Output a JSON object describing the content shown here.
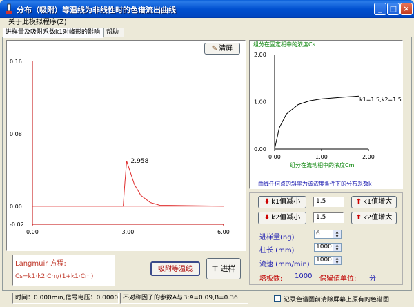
{
  "window": {
    "title": "分布（吸附）等温线为非线性时的色谱流出曲线",
    "buttons": {
      "minimize": "_",
      "maximize": "□",
      "close": "×"
    }
  },
  "menu": {
    "about": "关于此模拟程序(Z)"
  },
  "tabs": [
    {
      "label": "进样量及吸附系数k1对峰形的影响"
    },
    {
      "label": "帮助"
    }
  ],
  "left_chart": {
    "clear_button": "清屏",
    "y_ticks": [
      "0.16",
      "0.08",
      "0.00",
      "-0.02"
    ],
    "x_ticks": [
      "0.00",
      "3.00",
      "6.00"
    ],
    "peak_label": "2.958",
    "colors": {
      "axis": "#c00000",
      "curve": "#e03030",
      "baseline": "#e03030"
    },
    "chart_data": {
      "type": "line",
      "xlim": [
        0,
        6
      ],
      "ylim": [
        -0.02,
        0.16
      ],
      "baseline_y": 0.0,
      "series": [
        {
          "x": [
            0.0,
            2.85,
            2.9,
            2.958,
            3.05,
            3.2,
            3.4,
            3.7,
            4.0,
            6.0
          ],
          "y": [
            0.0,
            0.0,
            0.025,
            0.05,
            0.04,
            0.024,
            0.012,
            0.004,
            0.001,
            0.0
          ]
        }
      ]
    }
  },
  "right_chart": {
    "title": "组分在固定相中的浓度Cs",
    "x_label": "组分在流动相中的浓度Cm",
    "y_ticks": [
      "2.00",
      "1.00",
      "0.00"
    ],
    "x_ticks": [
      "0.00",
      "1.00",
      "2.00"
    ],
    "curve_label": "k1=1.5,k2=1.5",
    "colors": {
      "title": "#008000",
      "curve": "#000000"
    },
    "chart_data": {
      "type": "line",
      "xlim": [
        0,
        2
      ],
      "ylim": [
        0,
        2
      ],
      "series": [
        {
          "x": [
            0,
            0.1,
            0.25,
            0.5,
            0.75,
            1.0,
            1.25,
            1.5,
            1.8
          ],
          "y": [
            0,
            0.45,
            0.74,
            0.94,
            1.02,
            1.06,
            1.08,
            1.1,
            1.12
          ]
        }
      ]
    }
  },
  "slope_note": "曲线任何点的斜率为该浓度条件下的分布系数k",
  "controls": {
    "k1_decrease": "k1值减小",
    "k1_value": "1.5",
    "k1_increase": "k1值增大",
    "k2_decrease": "k2值减小",
    "k2_value": "1.5",
    "k2_increase": "k2值增大",
    "injection_label": "进样量(ng)",
    "injection_value": "6",
    "column_length_label": "柱长 (mm)",
    "column_length_value": "1000",
    "flow_rate_label": "流速 (mm/min)",
    "flow_rate_value": "1000",
    "plate_label": "塔板数:",
    "plate_value": "1000",
    "retention_unit_label": "保留值单位:",
    "retention_unit_value": "分"
  },
  "formula": {
    "title": "Langmuir 方程:",
    "body": "Cs=k1·k2·Cm/(1+k1·Cm)"
  },
  "actions": {
    "isotherm_button": "吸附等温线",
    "inject_button": "进样"
  },
  "status": {
    "time_voltage": "时间：0.000min,信号电压：0.0000mv",
    "asymmetry": "不对称因子的参数A与B:A=0.09,B=0.36",
    "checkbox_label": "记录色谱图前清除屏幕上原有的色谱图"
  }
}
